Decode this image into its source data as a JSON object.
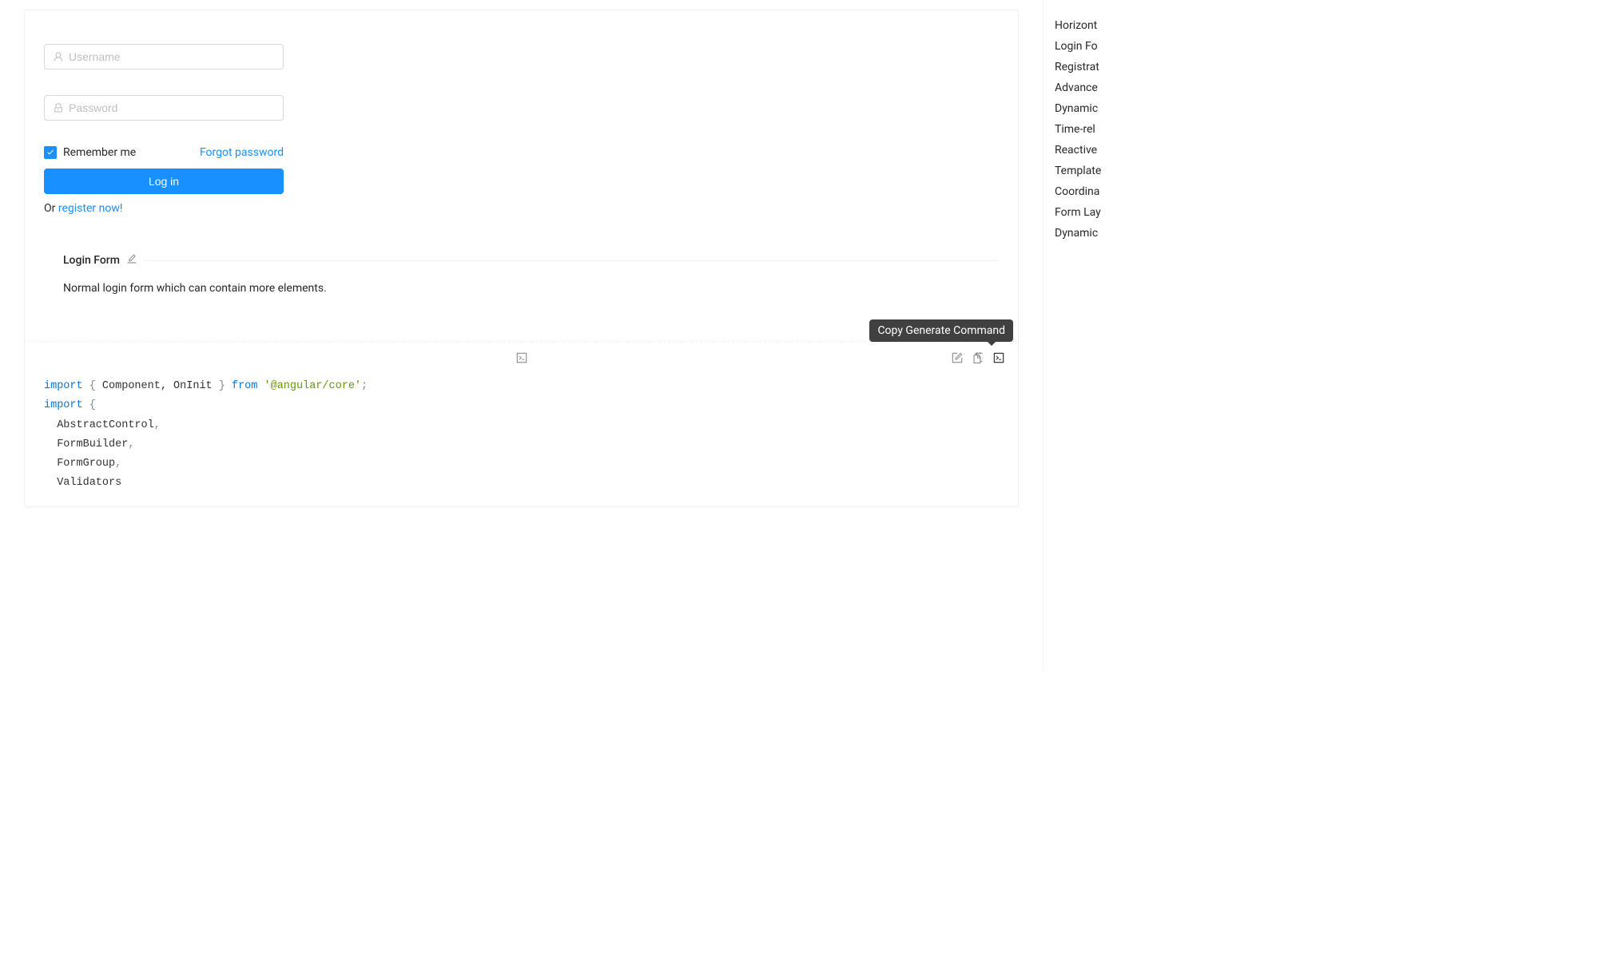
{
  "form": {
    "username_placeholder": "Username",
    "password_placeholder": "Password",
    "remember_label": "Remember me",
    "forgot_label": "Forgot password",
    "login_button": "Log in",
    "or_text": "Or ",
    "register_link": "register now!"
  },
  "section": {
    "title": "Login Form",
    "description": "Normal login form which can contain more elements."
  },
  "tooltip": {
    "copy_generate": "Copy Generate Command"
  },
  "code": {
    "import": "import",
    "from": "from",
    "brace_open": "{",
    "brace_close": "}",
    "component_oninit": " Component, OnInit ",
    "angular_core": "'@angular/core'",
    "semicolon": ";",
    "abstract_control": "AbstractControl",
    "form_builder": "FormBuilder",
    "form_group": "FormGroup",
    "validators": "Validators",
    "comma": ","
  },
  "nav": {
    "items": [
      "Horizont",
      "Login Fo",
      "Registrat",
      "Advance",
      "Dynamic",
      "Time-rel",
      "Reactive",
      "Template",
      "Coordina",
      "Form Lay",
      "Dynamic"
    ]
  }
}
